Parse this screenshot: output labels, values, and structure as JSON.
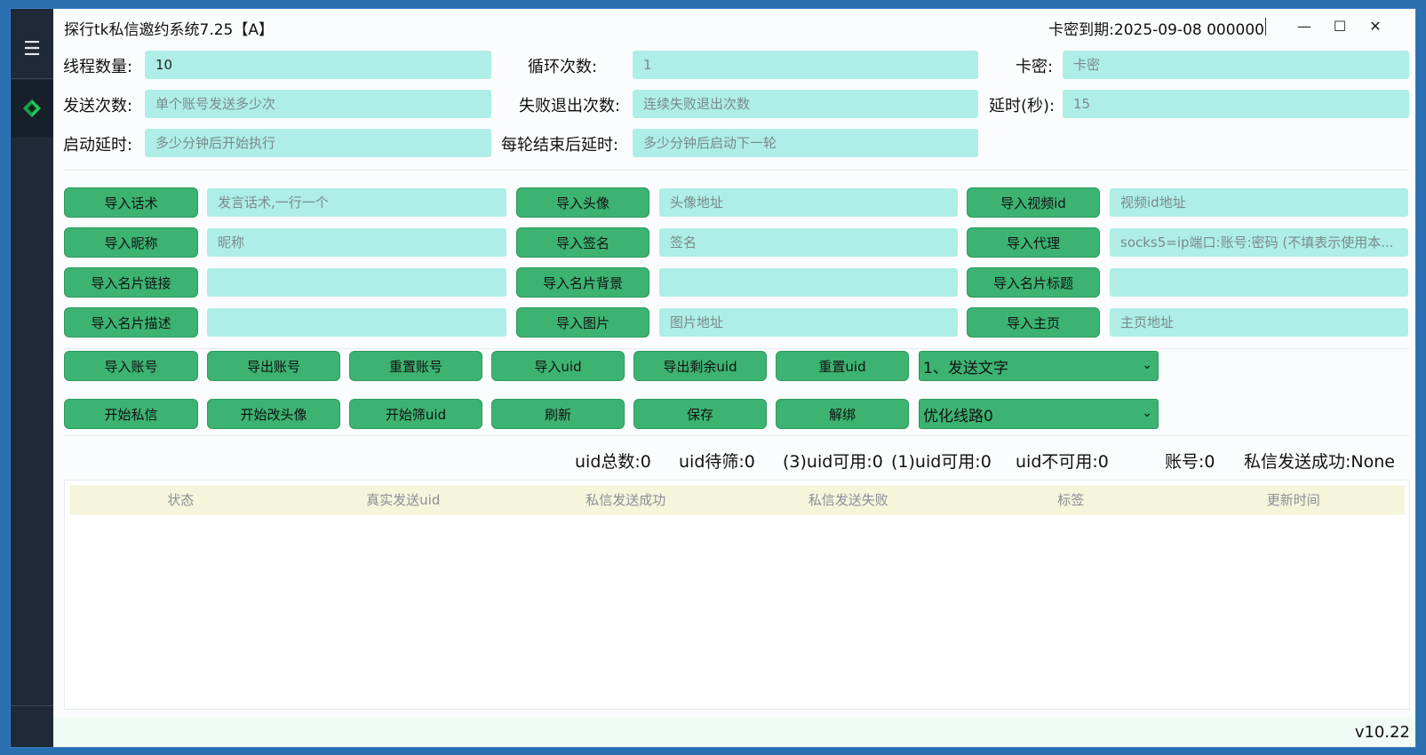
{
  "window": {
    "title": "探行tk私信邀约系统7.25【A】",
    "expiry": "卡密到期:2025-09-08 000000",
    "minimize_icon": "—",
    "maximize_icon": "☐",
    "close_icon": "✕"
  },
  "sidebar": {
    "menu_icon": "☰"
  },
  "params": {
    "threads_label": "线程数量:",
    "threads_value": "10",
    "loops_label": "循环次数:",
    "loops_placeholder": "1",
    "card_label": "卡密:",
    "card_placeholder": "卡密",
    "send_label": "发送次数:",
    "send_placeholder": "单个账号发送多少次",
    "fail_label": "失败退出次数:",
    "fail_placeholder": "连续失败退出次数",
    "delay_label": "延时(秒):",
    "delay_placeholder": "15",
    "start_delay_label": "启动延时:",
    "start_delay_placeholder": "多少分钟后开始执行",
    "round_delay_label": "每轮结束后延时:",
    "round_delay_placeholder": "多少分钟后启动下一轮"
  },
  "imports": {
    "script_btn": "导入话术",
    "script_placeholder": "发言话术,一行一个",
    "avatar_btn": "导入头像",
    "avatar_placeholder": "头像地址",
    "video_btn": "导入视频id",
    "video_placeholder": "视频id地址",
    "nick_btn": "导入昵称",
    "nick_placeholder": "昵称",
    "sign_btn": "导入签名",
    "sign_placeholder": "签名",
    "proxy_btn": "导入代理",
    "proxy_placeholder": "socks5=ip端口:账号:密码 (不填表示使用本...",
    "card_link_btn": "导入名片链接",
    "card_bg_btn": "导入名片背景",
    "card_title_btn": "导入名片标题",
    "card_desc_btn": "导入名片描述",
    "image_btn": "导入图片",
    "image_placeholder": "图片地址",
    "home_btn": "导入主页",
    "home_placeholder": "主页地址"
  },
  "actions": {
    "import_acc": "导入账号",
    "export_acc": "导出账号",
    "reset_acc": "重置账号",
    "import_uid": "导入uid",
    "export_uid": "导出剩余uid",
    "reset_uid": "重置uid",
    "mode_select": "1、发送文字",
    "start_dm": "开始私信",
    "start_avatar": "开始改头像",
    "start_filter": "开始筛uid",
    "refresh": "刷新",
    "save": "保存",
    "unbind": "解绑",
    "route_select": "优化线路0"
  },
  "stats": {
    "uid_total": "uid总数:0",
    "uid_pending": "uid待筛:0",
    "uid_avail3": "(3)uid可用:0",
    "uid_avail1": "(1)uid可用:0",
    "uid_unavail": "uid不可用:0",
    "accounts": "账号:0",
    "dm_success": "私信发送成功:None"
  },
  "table": {
    "columns": [
      "状态",
      "真实发送uid",
      "私信发送成功",
      "私信发送失败",
      "标签",
      "更新时间"
    ]
  },
  "footer": {
    "version": "v10.22"
  }
}
